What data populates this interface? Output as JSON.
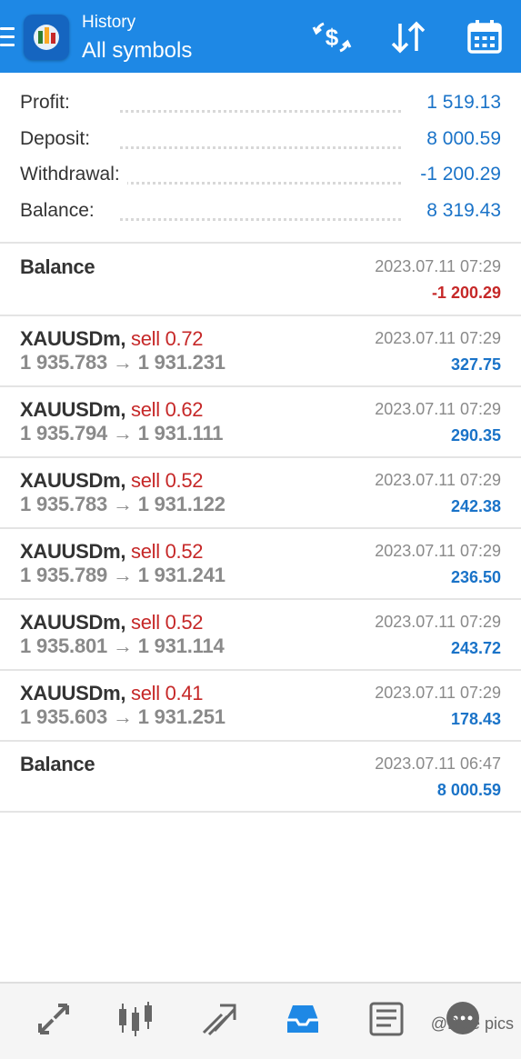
{
  "header": {
    "title_small": "History",
    "title_big": "All symbols",
    "background": "#1e88e5",
    "icons": [
      "menu-icon",
      "app-logo",
      "currency-exchange-icon",
      "sort-icon",
      "calendar-icon"
    ]
  },
  "summary": [
    {
      "label": "Profit:",
      "value": "1 519.13"
    },
    {
      "label": "Deposit:",
      "value": "8 000.59"
    },
    {
      "label": "Withdrawal:",
      "value": "-1 200.29"
    },
    {
      "label": "Balance:",
      "value": "8 319.43"
    }
  ],
  "deals": [
    {
      "symbol": "Balance",
      "side": "",
      "price": "",
      "time": "2023.07.11 07:29",
      "profit": "-1 200.29",
      "negative": true
    },
    {
      "symbol": "XAUUSDm,",
      "side": "sell 0.72",
      "price": "1 935.783 → 1 931.231",
      "time": "2023.07.11 07:29",
      "profit": "327.75",
      "negative": false
    },
    {
      "symbol": "XAUUSDm,",
      "side": "sell 0.62",
      "price": "1 935.794 → 1 931.111",
      "time": "2023.07.11 07:29",
      "profit": "290.35",
      "negative": false
    },
    {
      "symbol": "XAUUSDm,",
      "side": "sell 0.52",
      "price": "1 935.783 → 1 931.122",
      "time": "2023.07.11 07:29",
      "profit": "242.38",
      "negative": false
    },
    {
      "symbol": "XAUUSDm,",
      "side": "sell 0.52",
      "price": "1 935.789 → 1 931.241",
      "time": "2023.07.11 07:29",
      "profit": "236.50",
      "negative": false
    },
    {
      "symbol": "XAUUSDm,",
      "side": "sell 0.52",
      "price": "1 935.801 → 1 931.114",
      "time": "2023.07.11 07:29",
      "profit": "243.72",
      "negative": false
    },
    {
      "symbol": "XAUUSDm,",
      "side": "sell 0.41",
      "price": "1 935.603 → 1 931.251",
      "time": "2023.07.11 07:29",
      "profit": "178.43",
      "negative": false
    },
    {
      "symbol": "Balance",
      "side": "",
      "price": "",
      "time": "2023.07.11 06:47",
      "profit": "8 000.59",
      "negative": false
    }
  ],
  "colors": {
    "accent": "#1e88e5",
    "positive": "#1a73c8",
    "negative": "#c62828",
    "muted": "#8a8a8a"
  },
  "bottom_nav": {
    "items": [
      {
        "icon": "quotes-icon",
        "active": false
      },
      {
        "icon": "chart-icon",
        "active": false
      },
      {
        "icon": "trade-icon",
        "active": false
      },
      {
        "icon": "history-icon",
        "active": true
      },
      {
        "icon": "news-icon",
        "active": false
      },
      {
        "icon": "messages-icon",
        "active": false
      }
    ],
    "watermark": "@Blue pics"
  }
}
